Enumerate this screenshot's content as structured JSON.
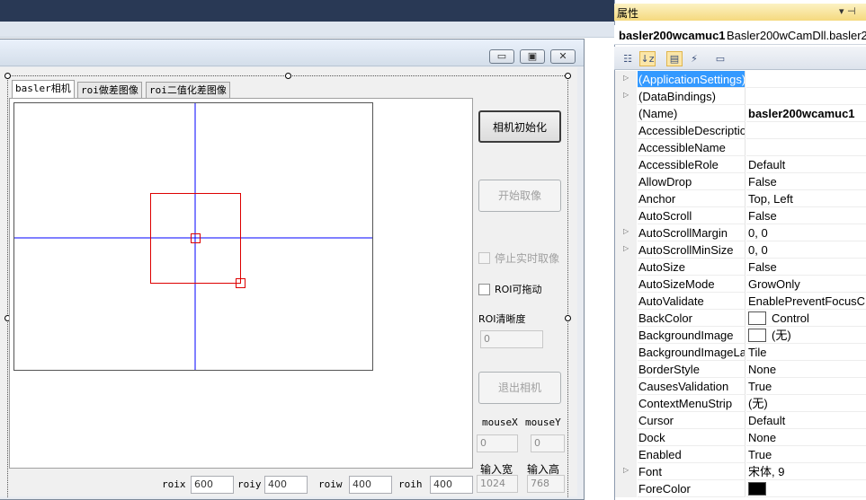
{
  "form": {
    "tabs": [
      {
        "label": "basler相机",
        "active": true
      },
      {
        "label": "roi做差图像",
        "active": false
      },
      {
        "label": "roi二值化差图像",
        "active": false
      }
    ],
    "buttons": {
      "init_camera": "相机初始化",
      "start_grab": "开始取像",
      "exit_camera": "退出相机"
    },
    "checkboxes": {
      "stop_realtime": "停止实时取像",
      "roi_draggable": "ROI可拖动"
    },
    "roi_sharpness": {
      "label": "ROI清晰度",
      "value": "0"
    },
    "mouse": {
      "x_label": "mouseX",
      "y_label": "mouseY",
      "x_value": "0",
      "y_value": "0"
    },
    "input_size": {
      "width_label": "输入宽",
      "height_label": "输入高",
      "width_value": "1024",
      "height_value": "768"
    },
    "roi_fields": [
      {
        "label": "roix",
        "value": "600"
      },
      {
        "label": "roiy",
        "value": "400"
      },
      {
        "label": "roiw",
        "value": "400"
      },
      {
        "label": "roih",
        "value": "400"
      }
    ],
    "caption_buttons": {
      "minimize": "▭",
      "maximize": "▣",
      "close": "✕"
    },
    "colors": {
      "crosshair": "#0000ff",
      "roi": "#dd0000"
    }
  },
  "properties": {
    "title": "属性",
    "pin_label": "▾ ⊣",
    "object_name": "basler200wcamuc1",
    "object_type": "Basler200wCamDll.basler2",
    "selection_color": "#3399ff",
    "rows": [
      {
        "name": "(ApplicationSettings)",
        "value": "",
        "expandable": true,
        "selected": true
      },
      {
        "name": "(DataBindings)",
        "value": "",
        "expandable": true
      },
      {
        "name": "(Name)",
        "value": "basler200wcamuc1",
        "bold": true
      },
      {
        "name": "AccessibleDescriptio",
        "value": ""
      },
      {
        "name": "AccessibleName",
        "value": ""
      },
      {
        "name": "AccessibleRole",
        "value": "Default"
      },
      {
        "name": "AllowDrop",
        "value": "False"
      },
      {
        "name": "Anchor",
        "value": "Top, Left"
      },
      {
        "name": "AutoScroll",
        "value": "False"
      },
      {
        "name": "AutoScrollMargin",
        "value": "0, 0",
        "expandable": true
      },
      {
        "name": "AutoScrollMinSize",
        "value": "0, 0",
        "expandable": true
      },
      {
        "name": "AutoSize",
        "value": "False"
      },
      {
        "name": "AutoSizeMode",
        "value": "GrowOnly"
      },
      {
        "name": "AutoValidate",
        "value": "EnablePreventFocusCh"
      },
      {
        "name": "BackColor",
        "value": "Control",
        "swatch": "#ffffff"
      },
      {
        "name": "BackgroundImage",
        "value": "(无)",
        "swatch": "#ffffff"
      },
      {
        "name": "BackgroundImageLa",
        "value": "Tile"
      },
      {
        "name": "BorderStyle",
        "value": "None"
      },
      {
        "name": "CausesValidation",
        "value": "True"
      },
      {
        "name": "ContextMenuStrip",
        "value": "(无)"
      },
      {
        "name": "Cursor",
        "value": "Default"
      },
      {
        "name": "Dock",
        "value": "None"
      },
      {
        "name": "Enabled",
        "value": "True"
      },
      {
        "name": "Font",
        "value": "宋体, 9",
        "expandable": true
      },
      {
        "name": "ForeColor",
        "value": "",
        "swatch": "#000000"
      }
    ]
  }
}
